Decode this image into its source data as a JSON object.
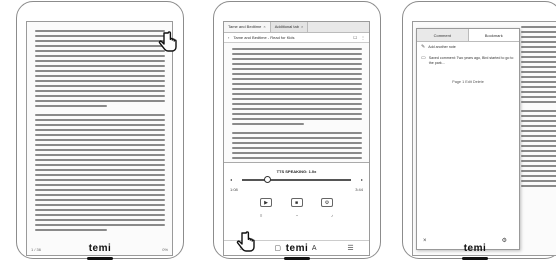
{
  "devices": [
    {
      "id": "reader",
      "logo": "temi",
      "footer_left": "1 / 36",
      "footer_right": "0%"
    },
    {
      "id": "browser",
      "logo": "temi",
      "tabs": [
        "Tame and Bedtime",
        "Additional tab"
      ],
      "url": "Tame and Bedtime - Read for Kids",
      "sheet_title": "TTS SPEAKING: 1.0x",
      "time_left": "1:08",
      "time_right": "3:44"
    },
    {
      "id": "annotations",
      "logo": "temi",
      "popup_tabs": [
        "Comment",
        "Bookmark"
      ],
      "items": [
        "Add another note",
        "Saved comment: Two years ago, Bird started to go to the park..."
      ],
      "link_text": "Page 1   Edit   Delete"
    }
  ]
}
